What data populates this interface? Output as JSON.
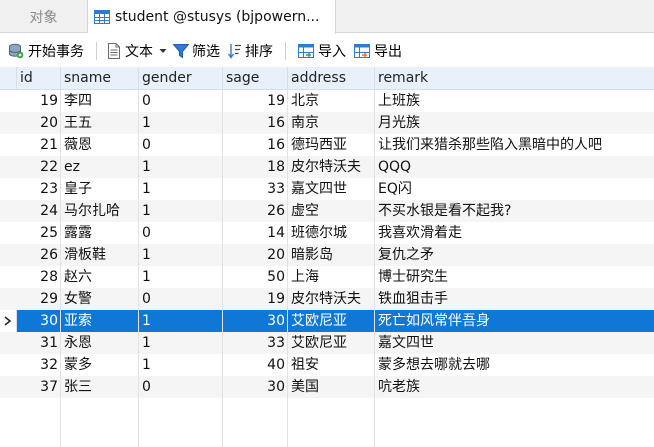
{
  "tabs": [
    {
      "label": "对象"
    },
    {
      "label": "student @stusys (bjpowern..."
    }
  ],
  "toolbar": {
    "begin_transaction": "开始事务",
    "text": "文本",
    "filter": "筛选",
    "sort": "排序",
    "import": "导入",
    "export": "导出"
  },
  "columns": [
    "id",
    "sname",
    "gender",
    "sage",
    "address",
    "remark"
  ],
  "rows": [
    {
      "id": "19",
      "sname": "李四",
      "gender": "0",
      "sage": "19",
      "address": "北京",
      "remark": "上班族"
    },
    {
      "id": "20",
      "sname": "王五",
      "gender": "1",
      "sage": "16",
      "address": "南京",
      "remark": "月光族"
    },
    {
      "id": "21",
      "sname": "薇恩",
      "gender": "0",
      "sage": "16",
      "address": "德玛西亚",
      "remark": "让我们来猎杀那些陷入黑暗中的人吧"
    },
    {
      "id": "22",
      "sname": "ez",
      "gender": "1",
      "sage": "18",
      "address": "皮尔特沃夫",
      "remark": "QQQ"
    },
    {
      "id": "23",
      "sname": "皇子",
      "gender": "1",
      "sage": "33",
      "address": "嘉文四世",
      "remark": "EQ闪"
    },
    {
      "id": "24",
      "sname": "马尔扎哈",
      "gender": "1",
      "sage": "26",
      "address": "虚空",
      "remark": "不买水银是看不起我?"
    },
    {
      "id": "25",
      "sname": "露露",
      "gender": "0",
      "sage": "14",
      "address": "班德尔城",
      "remark": "我喜欢滑着走"
    },
    {
      "id": "26",
      "sname": "滑板鞋",
      "gender": "1",
      "sage": "20",
      "address": "暗影岛",
      "remark": "复仇之矛"
    },
    {
      "id": "28",
      "sname": "赵六",
      "gender": "1",
      "sage": "50",
      "address": "上海",
      "remark": "博士研究生"
    },
    {
      "id": "29",
      "sname": "女警",
      "gender": "0",
      "sage": "19",
      "address": "皮尔特沃夫",
      "remark": "铁血狙击手"
    },
    {
      "id": "30",
      "sname": "亚索",
      "gender": "1",
      "sage": "30",
      "address": "艾欧尼亚",
      "remark": "死亡如风常伴吾身"
    },
    {
      "id": "31",
      "sname": "永恩",
      "gender": "1",
      "sage": "33",
      "address": "艾欧尼亚",
      "remark": "嘉文四世"
    },
    {
      "id": "32",
      "sname": "蒙多",
      "gender": "1",
      "sage": "40",
      "address": "祖安",
      "remark": "蒙多想去哪就去哪"
    },
    {
      "id": "37",
      "sname": "张三",
      "gender": "0",
      "sage": "30",
      "address": "美国",
      "remark": "吭老族"
    }
  ],
  "selected_row_index": 10,
  "colors": {
    "selection": "#0f78d6",
    "header_bg": "#e8f1fb",
    "alt_row": "#f5f5f5"
  }
}
